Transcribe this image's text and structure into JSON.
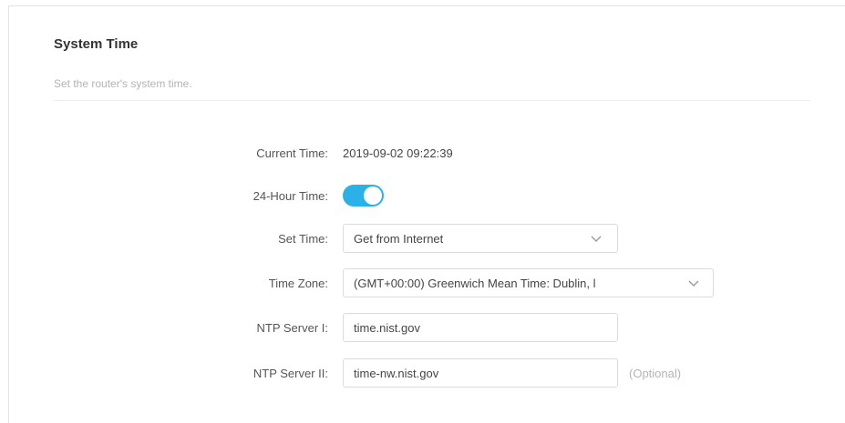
{
  "section": {
    "title": "System Time",
    "description": "Set the router's system time."
  },
  "current_time": {
    "label": "Current Time:",
    "value": "2019-09-02 09:22:39"
  },
  "hour24": {
    "label": "24-Hour Time:",
    "enabled": true,
    "accent_color": "#2cb0e8"
  },
  "set_time": {
    "label": "Set Time:",
    "selected": "Get from Internet",
    "icon": "chevron-down-icon"
  },
  "time_zone": {
    "label": "Time Zone:",
    "selected": "(GMT+00:00) Greenwich Mean Time: Dublin, l",
    "icon": "chevron-down-icon"
  },
  "ntp1": {
    "label": "NTP Server I:",
    "value": "time.nist.gov"
  },
  "ntp2": {
    "label": "NTP Server II:",
    "value": "time-nw.nist.gov",
    "note": "(Optional)"
  }
}
